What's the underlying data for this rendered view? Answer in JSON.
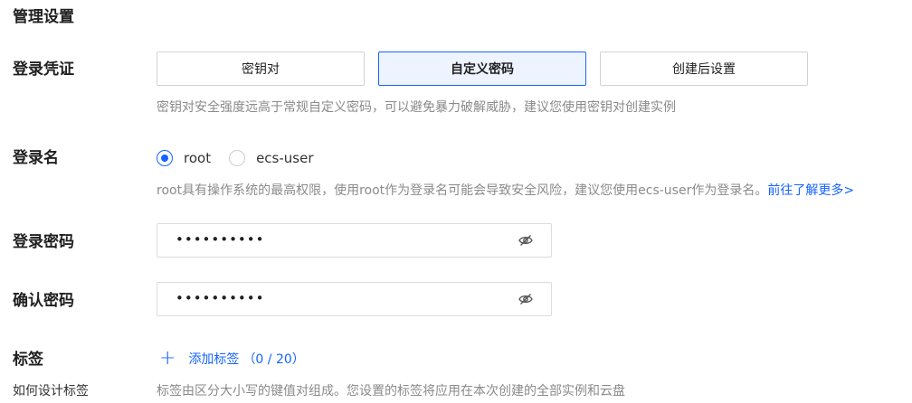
{
  "section": {
    "title": "管理设置"
  },
  "credential": {
    "label": "登录凭证",
    "options": [
      "密钥对",
      "自定义密码",
      "创建后设置"
    ],
    "selected": "自定义密码",
    "help": "密钥对安全强度远高于常规自定义密码，可以避免暴力破解威胁，建议您使用密钥对创建实例"
  },
  "login_name": {
    "label": "登录名",
    "options": [
      "root",
      "ecs-user"
    ],
    "selected": "root",
    "help": "root具有操作系统的最高权限，使用root作为登录名可能会导致安全风险，建议您使用ecs-user作为登录名。",
    "link": "前往了解更多>"
  },
  "password": {
    "label": "登录密码",
    "value": "••••••••••"
  },
  "confirm_password": {
    "label": "确认密码",
    "value": "••••••••••"
  },
  "tags": {
    "label": "标签",
    "sub_label": "如何设计标签",
    "add_label": "添加标签",
    "count": "（0 / 20）",
    "help": "标签由区分大小写的键值对组成。您设置的标签将应用在本次创建的全部实例和云盘"
  },
  "colors": {
    "accent": "#1664ff",
    "muted_text": "#8a8a8a",
    "border": "#d0d3d6"
  },
  "icons": {
    "password_toggle": "eye-slash-icon",
    "add": "plus-icon"
  }
}
